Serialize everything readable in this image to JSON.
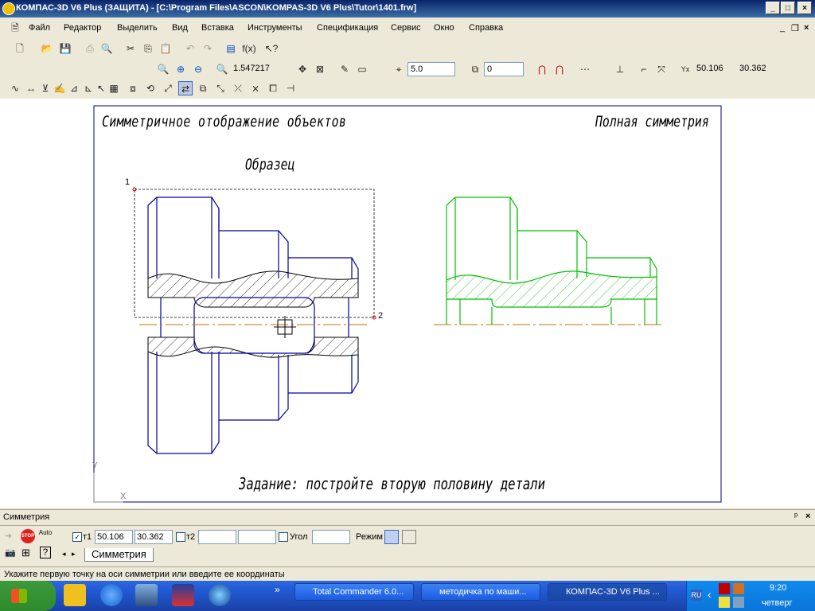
{
  "window": {
    "title": "КОМПАС-3D V6 Plus (ЗАЩИТА) - [C:\\Program Files\\ASCON\\KOMPAS-3D V6 Plus\\Tutor\\1401.frw]",
    "minimize": "_",
    "maximize": "□",
    "close": "×"
  },
  "menu": [
    "Файл",
    "Редактор",
    "Выделить",
    "Вид",
    "Вставка",
    "Инструменты",
    "Спецификация",
    "Сервис",
    "Окно",
    "Справка"
  ],
  "mdi_controls": {
    "minimize": "_",
    "restore": "❐",
    "close": "×"
  },
  "toolbar": {
    "zoom_value": "1.547217",
    "step_value": "5.0",
    "layer_value": "0",
    "coord_x": "50.106",
    "coord_y": "30.362",
    "fx_label": "f(x)"
  },
  "drawing": {
    "title_left": "Симметричное отображение объектов",
    "title_right": "Полная симметрия",
    "sample_label": "Образец",
    "point1": "1",
    "point2": "2",
    "task_text": "Задание: постройте вторую половину детали",
    "axis_y": "Y",
    "axis_x": "X"
  },
  "panel": {
    "title": "Симметрия",
    "pin": "ᵖ",
    "close": "×",
    "stop_label": "STOP",
    "auto_label": "Auto",
    "t1_label": "т1",
    "t1_x": "50.106",
    "t1_y": "30.362",
    "t2_label": "т2",
    "t2_x": "",
    "t2_y": "",
    "angle_label": "Угол",
    "angle_value": "",
    "mode_label": "Режим",
    "tab_label": "Симметрия",
    "tab_prev": "◂",
    "tab_next": "▸"
  },
  "status": {
    "text": "Укажите первую точку на оси симметрии или введите ее координаты"
  },
  "taskbar": {
    "overflow": "»",
    "tasks": [
      "Total Commander 6.0...",
      "методичка по маши...",
      "КОМПАС-3D V6 Plus ..."
    ],
    "lang": "RU",
    "time": "9:20",
    "day": "четверг"
  },
  "colors": {
    "sample_outline": "#0000a0",
    "mirror_outline": "#00c000",
    "axis": "#c07000",
    "frame": "#000080"
  }
}
